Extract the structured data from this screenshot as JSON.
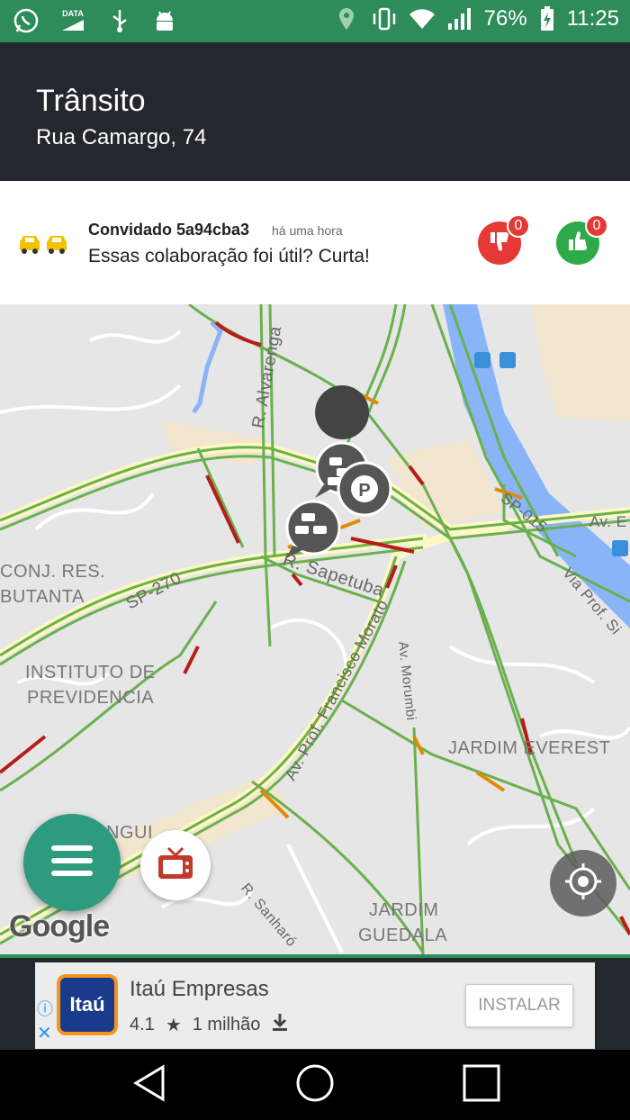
{
  "statusbar": {
    "data_label": "DATA",
    "battery": "76%",
    "time": "11:25"
  },
  "appbar": {
    "title": "Trânsito",
    "subtitle": "Rua Camargo, 74"
  },
  "report": {
    "author": "Convidado 5a94cba3",
    "time": "há uma hora",
    "message": "Essas colaboração foi útil? Curta!",
    "dislikes": "0",
    "likes": "0"
  },
  "map": {
    "labels": {
      "alvarenga": "R. Alvarenga",
      "sapetuba": "R. Sapetuba",
      "sp270": "SP-270",
      "sp015": "SP-015",
      "conj1": "CONJ. RES.",
      "conj2": "BUTANTA",
      "inst1": "INSTITUTO DE",
      "inst2": "PREVIDENCIA",
      "morato": "Av. Prof. Francisco Morato",
      "morumbi": "Av. Morumbi",
      "everest": "JARDIM EVEREST",
      "guedala1": "JARDIM",
      "guedala2": "GUEDALA",
      "sanharo": "R. Sanharó",
      "viaprof": "Via Prof. Si",
      "ave": "Av. E",
      "ngui": "NGUI"
    },
    "attribution": "Google"
  },
  "ad": {
    "name": "Itaú Empresas",
    "logo_text": "Itaú",
    "rating": "4.1",
    "downloads": "1 milhão",
    "install": "INSTALAR"
  },
  "colors": {
    "status_green": "#2e8b5a",
    "appbar_dark": "#23272e",
    "fab_green": "#2e9a7e",
    "traffic_green": "#6ab04c",
    "traffic_red": "#b71c1c",
    "traffic_orange": "#e08a00"
  }
}
